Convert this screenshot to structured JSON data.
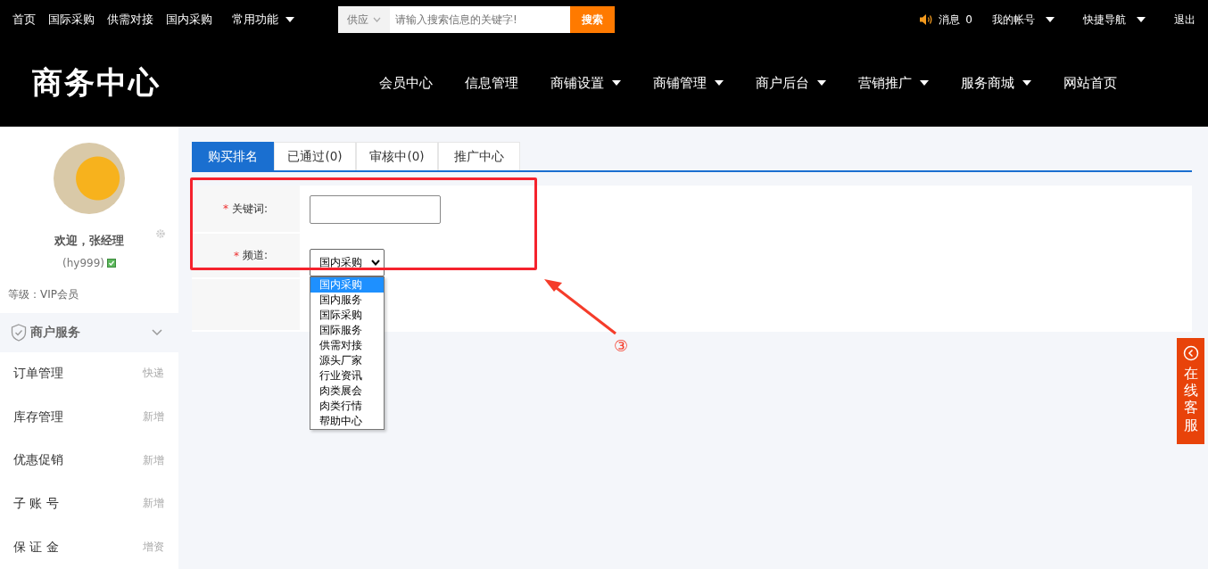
{
  "top_bar": {
    "links": [
      {
        "label": "首页",
        "dropdown": false
      },
      {
        "label": "国际采购",
        "dropdown": false
      },
      {
        "label": "供需对接",
        "dropdown": false
      },
      {
        "label": "国内采购",
        "dropdown": false
      },
      {
        "label": "常用功能",
        "dropdown": true
      }
    ],
    "search": {
      "scope": "供应",
      "placeholder": "请输入搜索信息的关键字!",
      "button": "搜索"
    },
    "right": [
      {
        "kind": "message",
        "label": "消息",
        "count": "0"
      },
      {
        "kind": "menu",
        "label": "我的帐号"
      },
      {
        "kind": "menu",
        "label": "快捷导航"
      },
      {
        "kind": "link",
        "label": "退出"
      }
    ]
  },
  "header": {
    "title": "商务中心",
    "nav": [
      {
        "label": "会员中心",
        "dropdown": false
      },
      {
        "label": "信息管理",
        "dropdown": false
      },
      {
        "label": "商铺设置",
        "dropdown": true
      },
      {
        "label": "商铺管理",
        "dropdown": true
      },
      {
        "label": "商户后台",
        "dropdown": true
      },
      {
        "label": "营销推广",
        "dropdown": true
      },
      {
        "label": "服务商城",
        "dropdown": true
      },
      {
        "label": "网站首页",
        "dropdown": false
      }
    ]
  },
  "sidebar": {
    "welcome": "欢迎，张经理",
    "username": "(hy999)",
    "verified": true,
    "level": "等级：VIP会员",
    "section": {
      "title": "商户服务",
      "expanded": true
    },
    "items": [
      {
        "label": "订单管理",
        "action": "快递"
      },
      {
        "label": "库存管理",
        "action": "新增"
      },
      {
        "label": "优惠促销",
        "action": "新增"
      },
      {
        "label": "子 账 号",
        "action": "新增"
      },
      {
        "label": "保 证 金",
        "action": "增资"
      }
    ]
  },
  "tabs": [
    {
      "label": "购买排名",
      "selected": true
    },
    {
      "label": "已通过(0)",
      "selected": false
    },
    {
      "label": "审核中(0)",
      "selected": false
    },
    {
      "label": "推广中心",
      "selected": false
    }
  ],
  "form": {
    "keyword": {
      "marker": "*",
      "label": "关键词:"
    },
    "channel": {
      "marker": "*",
      "label": "频道:",
      "value": "国内采购",
      "options": [
        {
          "label": "国内采购",
          "selected": true
        },
        {
          "label": "国内服务",
          "selected": false
        },
        {
          "label": "国际采购",
          "selected": false
        },
        {
          "label": "国际服务",
          "selected": false
        },
        {
          "label": "供需对接",
          "selected": false
        },
        {
          "label": "源头厂家",
          "selected": false
        },
        {
          "label": "行业资讯",
          "selected": false
        },
        {
          "label": "肉类展会",
          "selected": false
        },
        {
          "label": "肉类行情",
          "selected": false
        },
        {
          "label": "帮助中心",
          "selected": false
        }
      ]
    }
  },
  "annotation": {
    "label": "③"
  },
  "float_service": {
    "label": "在线客服"
  }
}
